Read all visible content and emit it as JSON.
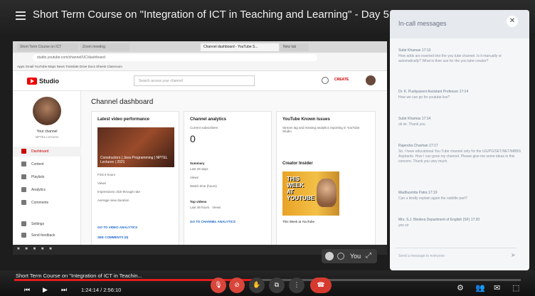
{
  "meeting": {
    "title": "Short Term Course on \"Integration of ICT in Teaching and Learning\" - Day 5"
  },
  "browser": {
    "tabs": [
      "Short Term Course on ICT",
      "Zoom meeting",
      "Channel dashboard - YouTube S...",
      "New tab"
    ],
    "address": "studio.youtube.com/channel/UC/dashboard",
    "bookmarks": "Apps   Gmail   YouTube   Maps   News   Translate   Drive   Docs   Sheets   Classroom"
  },
  "studio": {
    "logo_text": "Studio",
    "search_placeholder": "Search across your channel",
    "create_label": "CREATE",
    "channel_name": "Your channel",
    "channel_sub": "NPTEL Lectures",
    "sidebar": [
      {
        "label": "Dashboard",
        "active": true
      },
      {
        "label": "Content",
        "active": false
      },
      {
        "label": "Playlists",
        "active": false
      },
      {
        "label": "Analytics",
        "active": false
      },
      {
        "label": "Comments",
        "active": false
      },
      {
        "label": "Settings",
        "active": false
      },
      {
        "label": "Send feedback",
        "active": false
      }
    ],
    "dashboard_title": "Channel dashboard",
    "latest": {
      "title": "Latest video performance",
      "thumb_caption": "Constructors | Java Programming | NPTEL Lectures | 2021",
      "rows": [
        "First 6 hours",
        "Views",
        "Impressions click-through rate",
        "Average view duration"
      ],
      "link1": "GO TO VIDEO ANALYTICS",
      "link2": "SEE COMMENTS (0)"
    },
    "analytics": {
      "title": "Channel analytics",
      "subs_label": "Current subscribers",
      "subs_value": "0",
      "summary_label": "Summary",
      "summary_sub": "Last 28 days",
      "views_label": "Views",
      "watch_label": "Watch time (hours)",
      "top_label": "Top videos",
      "top_sub": "Last 48 hours · Views",
      "link": "GO TO CHANNEL ANALYTICS"
    },
    "known_issues": {
      "title": "YouTube Known Issues",
      "text": "Stream lag and missing analytics reporting in YouTube Studio"
    },
    "creator": {
      "title": "Creator Insider",
      "thumb_words": [
        "THIS",
        "WEEK",
        "AT",
        "YOUTUBE"
      ],
      "caption": "This Week at YouTube"
    }
  },
  "you_tile": {
    "label": "You"
  },
  "chat": {
    "title": "In-call messages",
    "messages": [
      {
        "sender": "Subir Khamas  17:13",
        "text": "How adds are inserted into the you tube channel. Is it manually or automatically? What is their use for the you tube creator?"
      },
      {
        "sender": "Dr. K. Pushpaveni Assistant Professor  17:14",
        "text": "How we can go for youtube live?"
      },
      {
        "sender": "Subir Khamas  17:14",
        "text": "ok sir. Thank you"
      },
      {
        "sender": "Rajendra Chavhan  17:17",
        "text": "Sir, I have educational You Tube channel only for the UG/PG/SET/NET/MBBS Aspirants. How I can grow my channel. Please give me some ideas in this concern. Thank you very much."
      },
      {
        "sender": "Madhusmita Patra  17:19",
        "text": "Can u kindly explain again the subtitle part?"
      },
      {
        "sender": "Mrs. S.J. Bindera Department of English (SF)  17:20",
        "text": "yes sir"
      }
    ],
    "input_placeholder": "Send a message to everyone"
  },
  "player": {
    "video_title": "Short Term Course on \"Integration of ICT in Teachin...",
    "time": "1:24:14 / 2:56:10",
    "progress": 0.476
  }
}
